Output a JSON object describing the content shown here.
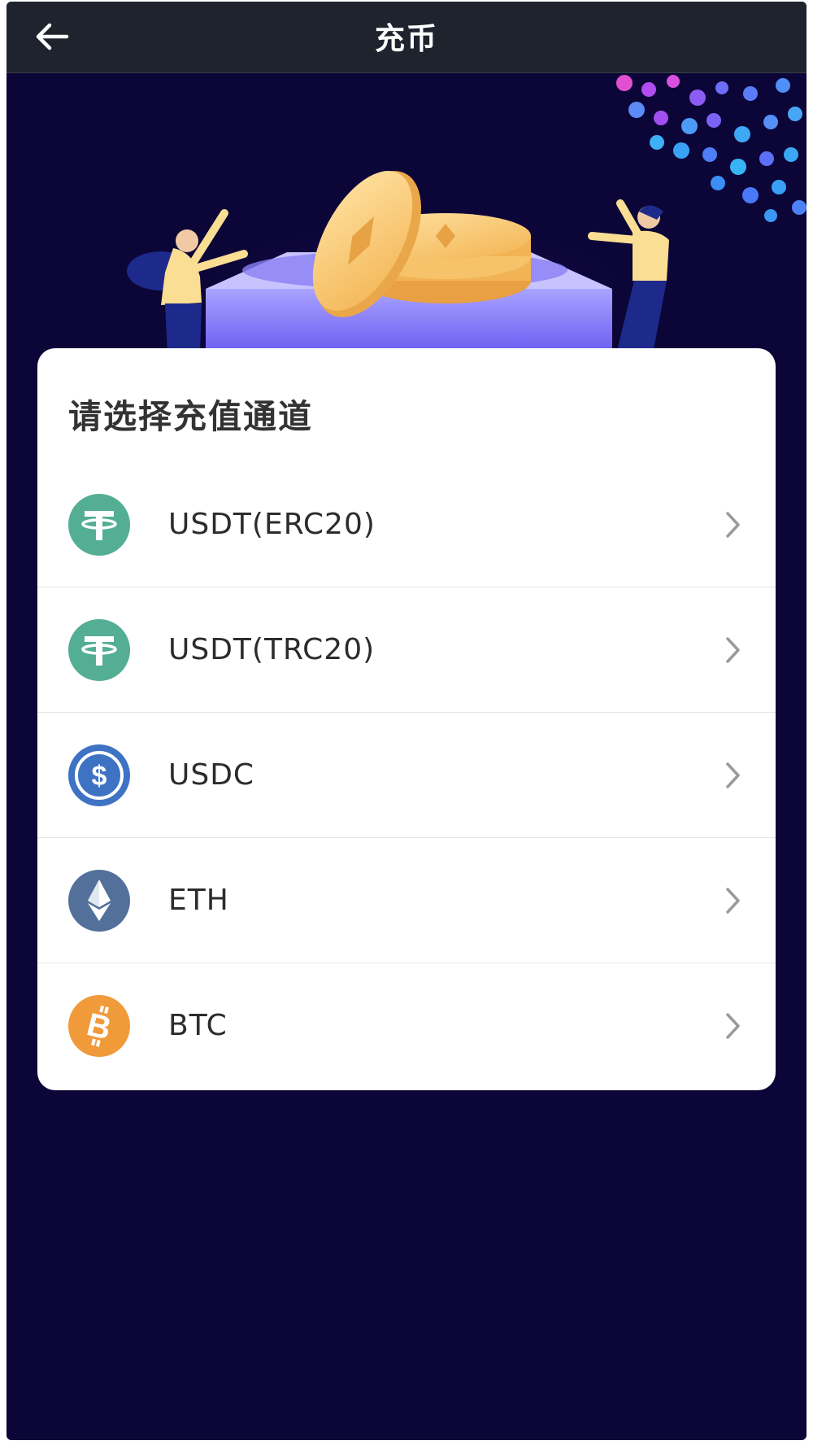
{
  "header": {
    "title": "充币",
    "back_icon": "arrow-left-icon"
  },
  "card": {
    "title": "请选择充值通道",
    "channels": [
      {
        "label": "USDT(ERC20)",
        "icon": "tether-icon",
        "color": "#53ae94"
      },
      {
        "label": "USDT(TRC20)",
        "icon": "tether-icon",
        "color": "#53ae94"
      },
      {
        "label": "USDC",
        "icon": "usdc-icon",
        "color": "#3e73c4"
      },
      {
        "label": "ETH",
        "icon": "ethereum-icon",
        "color": "#53709b"
      },
      {
        "label": "BTC",
        "icon": "bitcoin-icon",
        "color": "#f09a3a"
      }
    ]
  },
  "colors": {
    "page_background": "#0c0537",
    "header_background": "#1e232e",
    "card_background": "#ffffff"
  }
}
